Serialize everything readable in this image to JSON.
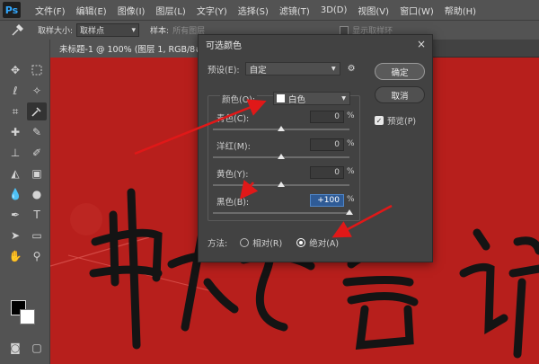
{
  "app": {
    "logo": "Ps"
  },
  "menubar": {
    "items": [
      "文件(F)",
      "编辑(E)",
      "图像(I)",
      "图层(L)",
      "文字(Y)",
      "选择(S)",
      "滤镜(T)",
      "3D(D)",
      "视图(V)",
      "窗口(W)",
      "帮助(H)"
    ]
  },
  "options_bar": {
    "sample_size_label": "取样大小:",
    "sample_size_value": "取样点",
    "sample_label": "样本:",
    "sample_value": "所有图层",
    "show_ring_label": "显示取样环"
  },
  "document_tab": {
    "title": "未标题-1 @ 100% (图层 1, RGB/8#) *",
    "close": "×"
  },
  "dialog": {
    "title": "可选颜色",
    "close": "×",
    "preset_label": "预设(E):",
    "preset_value": "自定",
    "ok_label": "确定",
    "cancel_label": "取消",
    "preview_label": "预览(P)",
    "preview_checked": true,
    "color_label": "颜色(O):",
    "color_value": "白色",
    "sliders": [
      {
        "label": "青色(C):",
        "value": "0",
        "unit": "%",
        "level": 0.5
      },
      {
        "label": "洋红(M):",
        "value": "0",
        "unit": "%",
        "level": 0.5
      },
      {
        "label": "黄色(Y):",
        "value": "0",
        "unit": "%",
        "level": 0.5
      },
      {
        "label": "黑色(B):",
        "value": "+100",
        "unit": "%",
        "level": 1.0
      }
    ],
    "method_label": "方法:",
    "method_relative": "相对(R)",
    "method_absolute": "绝对(A)",
    "method_selected": "绝对(A)"
  },
  "canvas": {
    "background_color": "#b71f1c",
    "text_color": "#111111",
    "arrow_color": "#e01818"
  }
}
